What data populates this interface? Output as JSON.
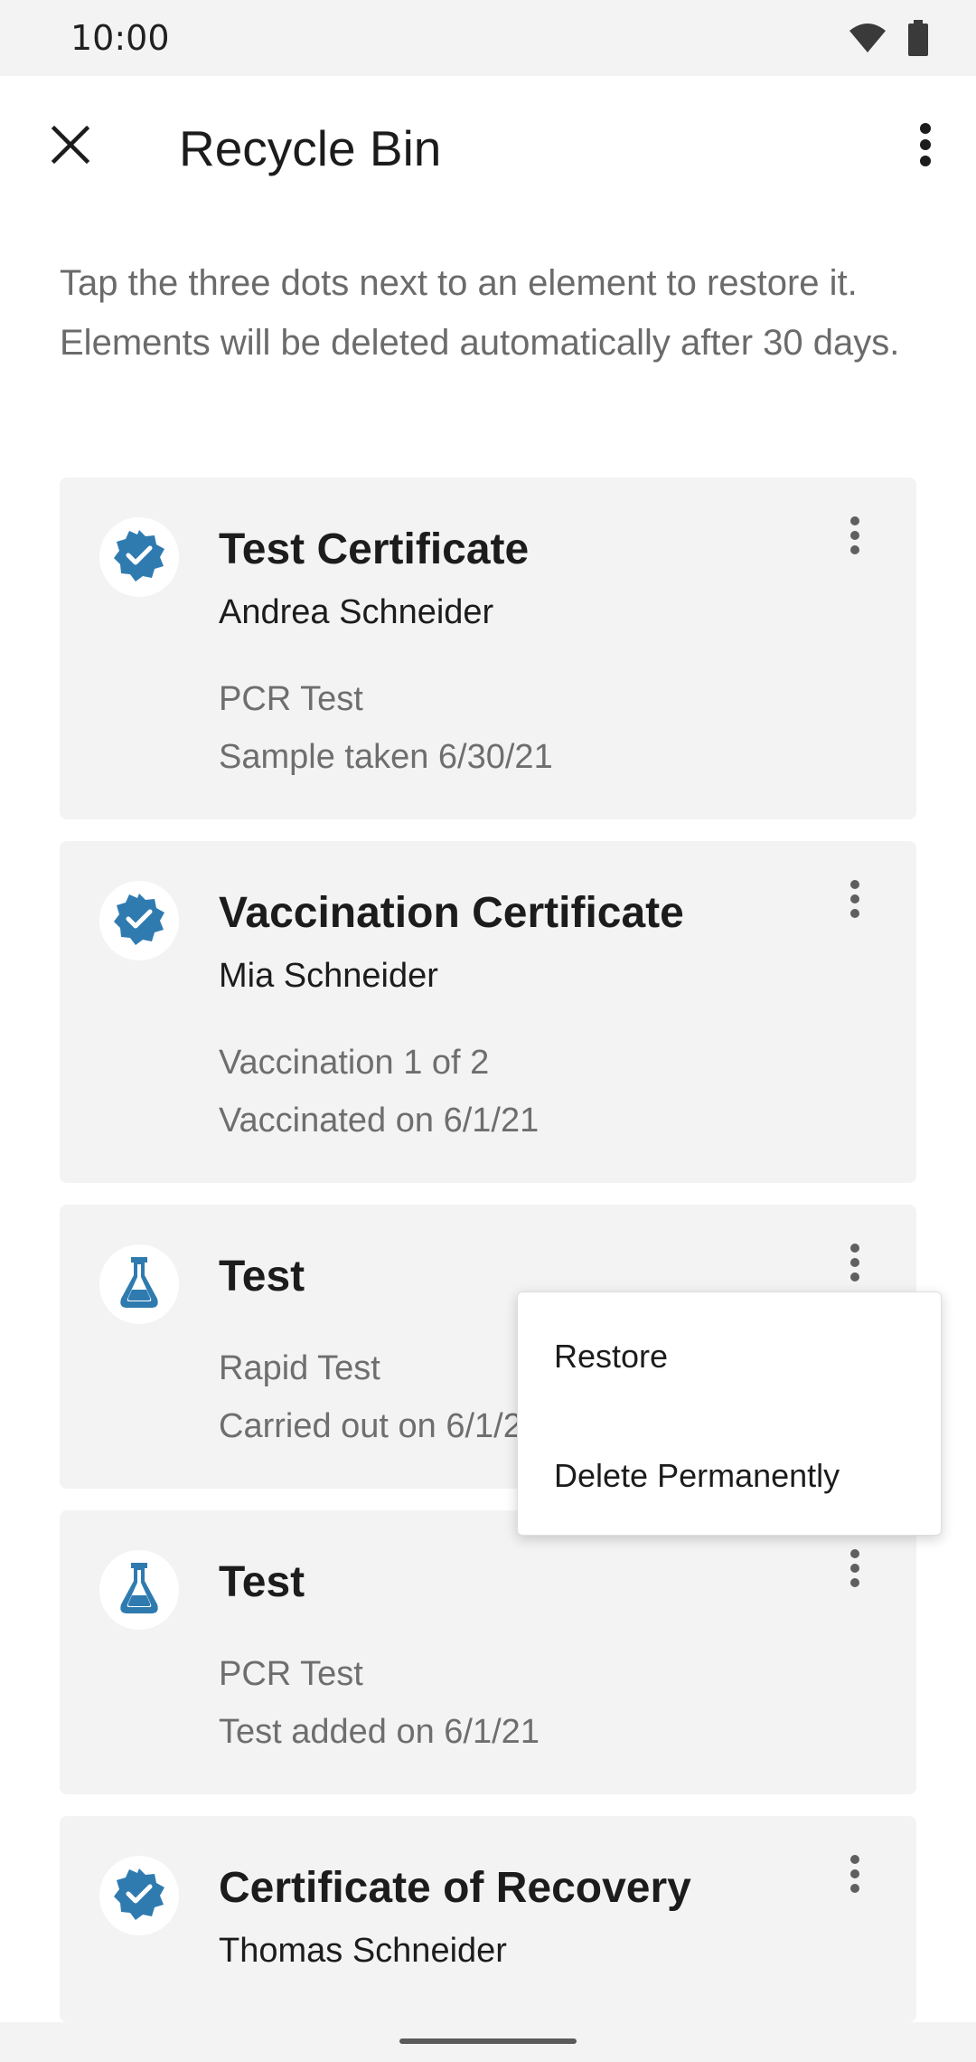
{
  "status_bar": {
    "time": "10:00",
    "icons": [
      "wifi-icon",
      "battery-icon"
    ]
  },
  "app_bar": {
    "title": "Recycle Bin",
    "close_icon": "close-icon",
    "more_icon": "more-vert-icon"
  },
  "intro": "Tap the three dots next to an element to restore it. Elements will be deleted automatically after 30 days.",
  "cards": [
    {
      "icon": "verified-badge-icon",
      "title": "Test Certificate",
      "name": "Andrea Schneider",
      "line1": "PCR Test",
      "line2": "Sample taken 6/30/21"
    },
    {
      "icon": "verified-badge-icon",
      "title": "Vaccination Certificate",
      "name": "Mia Schneider",
      "line1": "Vaccination 1 of 2",
      "line2": "Vaccinated on 6/1/21"
    },
    {
      "icon": "flask-icon",
      "title": "Test",
      "line1": "Rapid Test",
      "line2": "Carried out on 6/1/21"
    },
    {
      "icon": "flask-icon",
      "title": "Test",
      "line1": "PCR Test",
      "line2": "Test added on 6/1/21"
    },
    {
      "icon": "verified-badge-icon",
      "title": "Certificate of Recovery",
      "name": "Thomas Schneider"
    }
  ],
  "menu": {
    "restore": "Restore",
    "delete": "Delete Permanently"
  },
  "colors": {
    "accent": "#2f7bb0",
    "card_bg": "#f3f3f3"
  }
}
